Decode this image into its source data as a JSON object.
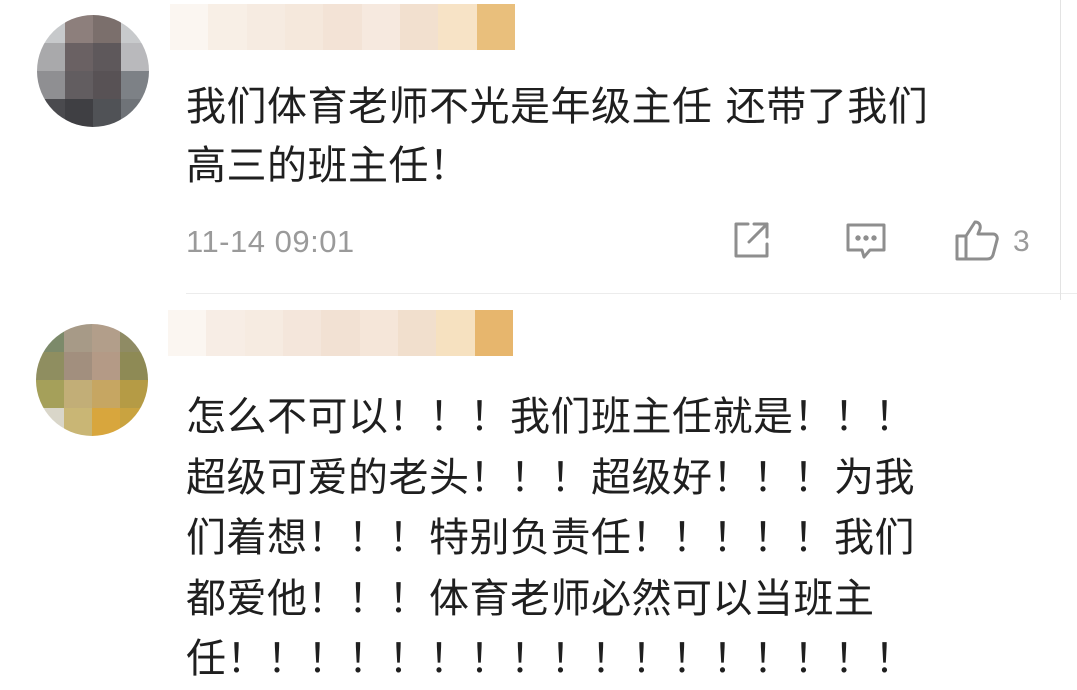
{
  "comments": [
    {
      "username": "",
      "text_lines": [
        "我们体育老师不光是年级主任 还带了我们",
        "高三的班主任！"
      ],
      "time": "11-14 09:01",
      "actions": {
        "share_icon": "share-external-icon",
        "reply_icon": "comment-bubble-icon",
        "like_icon": "thumbs-up-icon",
        "like_count": "3"
      }
    },
    {
      "username": "",
      "text_lines": [
        "怎么不可以！！！我们班主任就是！！！",
        "超级可爱的老头！！！超级好！！！为我",
        "们着想！！！特别负责任！！！！！我们",
        "都爱他！！！体育老师必然可以当班主",
        "任！！！！！！！！！！！！！！！！！"
      ]
    }
  ],
  "colors": {
    "text": "#1f1f1f",
    "meta": "#9a9a9a",
    "icon": "#8e8e8e"
  }
}
